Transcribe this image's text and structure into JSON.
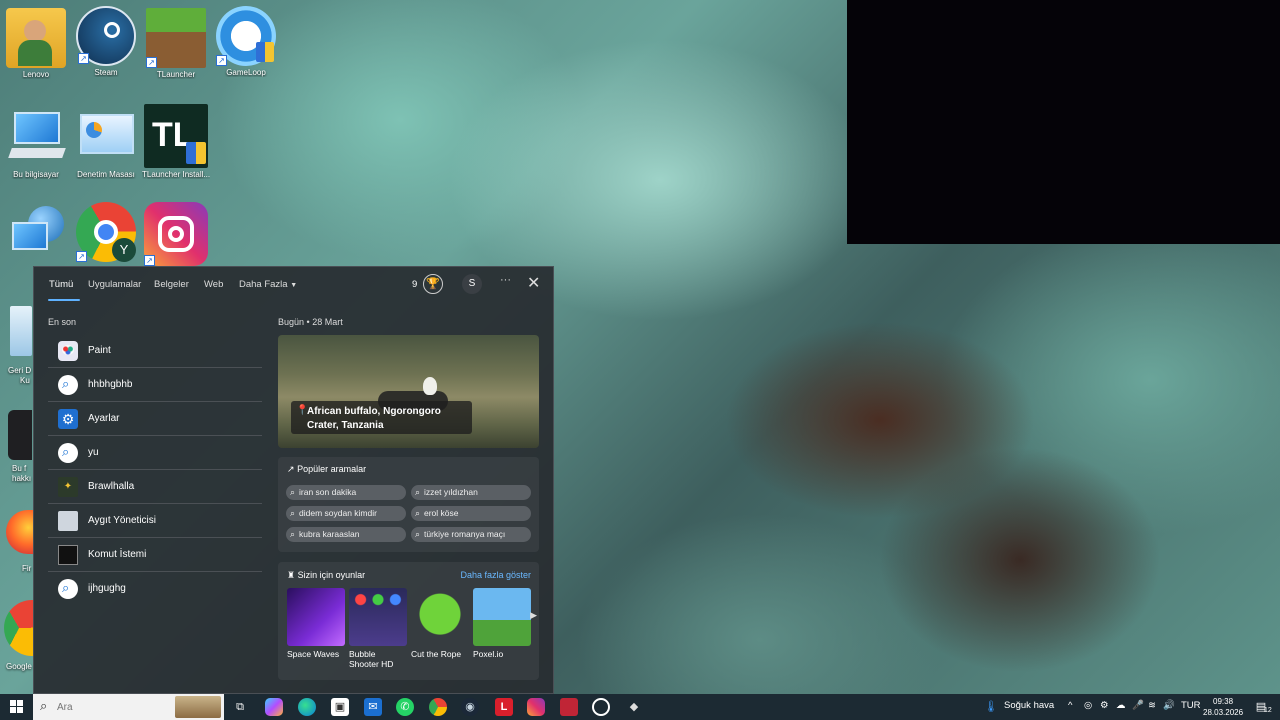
{
  "desktop": {
    "icons": [
      {
        "label": "Lenovo"
      },
      {
        "label": "Steam"
      },
      {
        "label": "TLauncher"
      },
      {
        "label": "GameLoop"
      },
      {
        "label": "Bu bilgisayar"
      },
      {
        "label": "Denetim Masası"
      },
      {
        "label": "TLauncher Install..."
      },
      {
        "label": ""
      },
      {
        "label": ""
      },
      {
        "label": ""
      }
    ],
    "partial_labels": [
      "Geri D",
      "Ku",
      "Bu f",
      "hakkı",
      "Fir",
      "Google"
    ]
  },
  "search_panel": {
    "tabs": [
      "Tümü",
      "Uygulamalar",
      "Belgeler",
      "Web",
      "Daha Fazla"
    ],
    "points": "9",
    "avatar_initial": "S",
    "more_glyph": "···",
    "close_glyph": "✕",
    "recent_title": "En son",
    "recent": [
      {
        "label": "Paint",
        "icon": "paint-icon"
      },
      {
        "label": "hhbhgbhb",
        "icon": "search-icon"
      },
      {
        "label": "Ayarlar",
        "icon": "gear-icon"
      },
      {
        "label": "yu",
        "icon": "search-icon"
      },
      {
        "label": "Brawlhalla",
        "icon": "brawlhalla-icon"
      },
      {
        "label": "Aygıt Yöneticisi",
        "icon": "device-manager-icon"
      },
      {
        "label": "Komut İstemi",
        "icon": "command-prompt-icon"
      },
      {
        "label": "ijhgughg",
        "icon": "search-icon"
      }
    ],
    "today": {
      "label": "Bugün",
      "date": "28 Mart"
    },
    "hero_caption": "African buffalo, Ngorongoro Crater, Tanzania",
    "popular": {
      "title": "Popüler aramalar",
      "items": [
        "iran son dakika",
        "izzet yıldızhan",
        "didem soydan kimdir",
        "erol köse",
        "kubra karaaslan",
        "türkiye romanya maçı"
      ]
    },
    "games": {
      "title": "Sizin için oyunlar",
      "more": "Daha fazla göster",
      "items": [
        "Space Waves",
        "Bubble Shooter HD",
        "Cut the Rope",
        "Poxel.io"
      ]
    }
  },
  "taskbar": {
    "search_placeholder": "Ara",
    "weather": "Soğuk hava",
    "language": "TUR",
    "time": "09:38",
    "date": "28.03.2026",
    "notification_count": "12"
  }
}
